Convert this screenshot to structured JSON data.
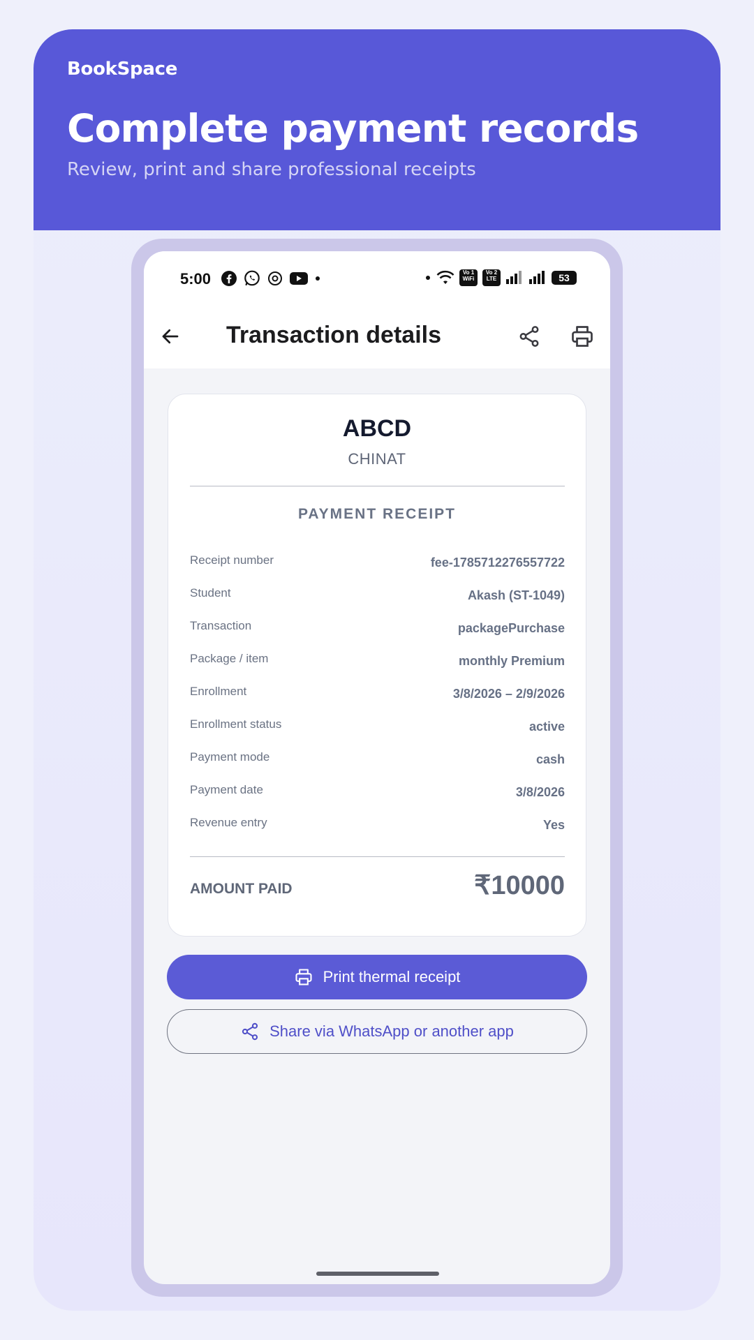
{
  "brand": "BookSpace",
  "hero": {
    "title": "Complete payment records",
    "subtitle": "Review, print and share professional receipts"
  },
  "status_bar": {
    "time": "5:00",
    "battery": "53",
    "left_icons": [
      "facebook-icon",
      "whatsapp-icon",
      "threads-icon",
      "youtube-icon",
      "dot-icon"
    ],
    "right_icons": [
      "dot-icon",
      "wifi-icon",
      "vowifi-icon",
      "volte-icon",
      "signal-icon",
      "signal-icon",
      "battery-icon"
    ],
    "vowifi_label": "Vo 1 WiFi",
    "volte_label": "Vo 2 LTE"
  },
  "app_bar": {
    "title": "Transaction details",
    "icons": [
      "back-arrow-icon",
      "share-icon",
      "print-icon"
    ]
  },
  "receipt": {
    "business_name": "ABCD",
    "business_sub": "CHINAT",
    "heading": "PAYMENT RECEIPT",
    "rows": [
      {
        "label": "Receipt number",
        "value": "fee-1785712276557722"
      },
      {
        "label": "Student",
        "value": "Akash (ST-1049)"
      },
      {
        "label": "Transaction",
        "value": "packagePurchase"
      },
      {
        "label": "Package / item",
        "value": "monthly Premium"
      },
      {
        "label": "Enrollment",
        "value": "3/8/2026 – 2/9/2026"
      },
      {
        "label": "Enrollment status",
        "value": "active"
      },
      {
        "label": "Payment mode",
        "value": "cash"
      },
      {
        "label": "Payment date",
        "value": "3/8/2026"
      },
      {
        "label": "Revenue entry",
        "value": "Yes"
      }
    ],
    "amount_label": "AMOUNT PAID",
    "amount_value": "₹10000"
  },
  "actions": {
    "print_label": "Print thermal receipt",
    "share_label": "Share via WhatsApp or another app"
  },
  "colors": {
    "accent": "#5b5bd6",
    "hero_bg": "#5858d8",
    "page_bg": "#eff0fb",
    "phone_frame": "#cbc7e9"
  }
}
